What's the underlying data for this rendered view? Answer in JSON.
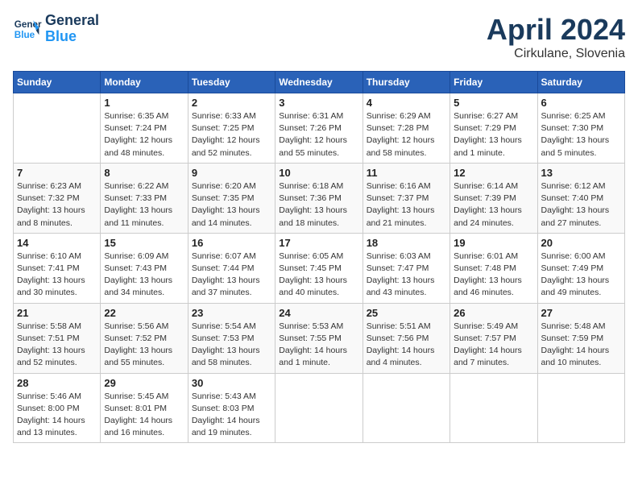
{
  "header": {
    "logo_line1": "General",
    "logo_line2": "Blue",
    "month": "April 2024",
    "location": "Cirkulane, Slovenia"
  },
  "weekdays": [
    "Sunday",
    "Monday",
    "Tuesday",
    "Wednesday",
    "Thursday",
    "Friday",
    "Saturday"
  ],
  "weeks": [
    [
      {
        "day": "",
        "info": ""
      },
      {
        "day": "1",
        "info": "Sunrise: 6:35 AM\nSunset: 7:24 PM\nDaylight: 12 hours\nand 48 minutes."
      },
      {
        "day": "2",
        "info": "Sunrise: 6:33 AM\nSunset: 7:25 PM\nDaylight: 12 hours\nand 52 minutes."
      },
      {
        "day": "3",
        "info": "Sunrise: 6:31 AM\nSunset: 7:26 PM\nDaylight: 12 hours\nand 55 minutes."
      },
      {
        "day": "4",
        "info": "Sunrise: 6:29 AM\nSunset: 7:28 PM\nDaylight: 12 hours\nand 58 minutes."
      },
      {
        "day": "5",
        "info": "Sunrise: 6:27 AM\nSunset: 7:29 PM\nDaylight: 13 hours\nand 1 minute."
      },
      {
        "day": "6",
        "info": "Sunrise: 6:25 AM\nSunset: 7:30 PM\nDaylight: 13 hours\nand 5 minutes."
      }
    ],
    [
      {
        "day": "7",
        "info": "Sunrise: 6:23 AM\nSunset: 7:32 PM\nDaylight: 13 hours\nand 8 minutes."
      },
      {
        "day": "8",
        "info": "Sunrise: 6:22 AM\nSunset: 7:33 PM\nDaylight: 13 hours\nand 11 minutes."
      },
      {
        "day": "9",
        "info": "Sunrise: 6:20 AM\nSunset: 7:35 PM\nDaylight: 13 hours\nand 14 minutes."
      },
      {
        "day": "10",
        "info": "Sunrise: 6:18 AM\nSunset: 7:36 PM\nDaylight: 13 hours\nand 18 minutes."
      },
      {
        "day": "11",
        "info": "Sunrise: 6:16 AM\nSunset: 7:37 PM\nDaylight: 13 hours\nand 21 minutes."
      },
      {
        "day": "12",
        "info": "Sunrise: 6:14 AM\nSunset: 7:39 PM\nDaylight: 13 hours\nand 24 minutes."
      },
      {
        "day": "13",
        "info": "Sunrise: 6:12 AM\nSunset: 7:40 PM\nDaylight: 13 hours\nand 27 minutes."
      }
    ],
    [
      {
        "day": "14",
        "info": "Sunrise: 6:10 AM\nSunset: 7:41 PM\nDaylight: 13 hours\nand 30 minutes."
      },
      {
        "day": "15",
        "info": "Sunrise: 6:09 AM\nSunset: 7:43 PM\nDaylight: 13 hours\nand 34 minutes."
      },
      {
        "day": "16",
        "info": "Sunrise: 6:07 AM\nSunset: 7:44 PM\nDaylight: 13 hours\nand 37 minutes."
      },
      {
        "day": "17",
        "info": "Sunrise: 6:05 AM\nSunset: 7:45 PM\nDaylight: 13 hours\nand 40 minutes."
      },
      {
        "day": "18",
        "info": "Sunrise: 6:03 AM\nSunset: 7:47 PM\nDaylight: 13 hours\nand 43 minutes."
      },
      {
        "day": "19",
        "info": "Sunrise: 6:01 AM\nSunset: 7:48 PM\nDaylight: 13 hours\nand 46 minutes."
      },
      {
        "day": "20",
        "info": "Sunrise: 6:00 AM\nSunset: 7:49 PM\nDaylight: 13 hours\nand 49 minutes."
      }
    ],
    [
      {
        "day": "21",
        "info": "Sunrise: 5:58 AM\nSunset: 7:51 PM\nDaylight: 13 hours\nand 52 minutes."
      },
      {
        "day": "22",
        "info": "Sunrise: 5:56 AM\nSunset: 7:52 PM\nDaylight: 13 hours\nand 55 minutes."
      },
      {
        "day": "23",
        "info": "Sunrise: 5:54 AM\nSunset: 7:53 PM\nDaylight: 13 hours\nand 58 minutes."
      },
      {
        "day": "24",
        "info": "Sunrise: 5:53 AM\nSunset: 7:55 PM\nDaylight: 14 hours\nand 1 minute."
      },
      {
        "day": "25",
        "info": "Sunrise: 5:51 AM\nSunset: 7:56 PM\nDaylight: 14 hours\nand 4 minutes."
      },
      {
        "day": "26",
        "info": "Sunrise: 5:49 AM\nSunset: 7:57 PM\nDaylight: 14 hours\nand 7 minutes."
      },
      {
        "day": "27",
        "info": "Sunrise: 5:48 AM\nSunset: 7:59 PM\nDaylight: 14 hours\nand 10 minutes."
      }
    ],
    [
      {
        "day": "28",
        "info": "Sunrise: 5:46 AM\nSunset: 8:00 PM\nDaylight: 14 hours\nand 13 minutes."
      },
      {
        "day": "29",
        "info": "Sunrise: 5:45 AM\nSunset: 8:01 PM\nDaylight: 14 hours\nand 16 minutes."
      },
      {
        "day": "30",
        "info": "Sunrise: 5:43 AM\nSunset: 8:03 PM\nDaylight: 14 hours\nand 19 minutes."
      },
      {
        "day": "",
        "info": ""
      },
      {
        "day": "",
        "info": ""
      },
      {
        "day": "",
        "info": ""
      },
      {
        "day": "",
        "info": ""
      }
    ]
  ]
}
